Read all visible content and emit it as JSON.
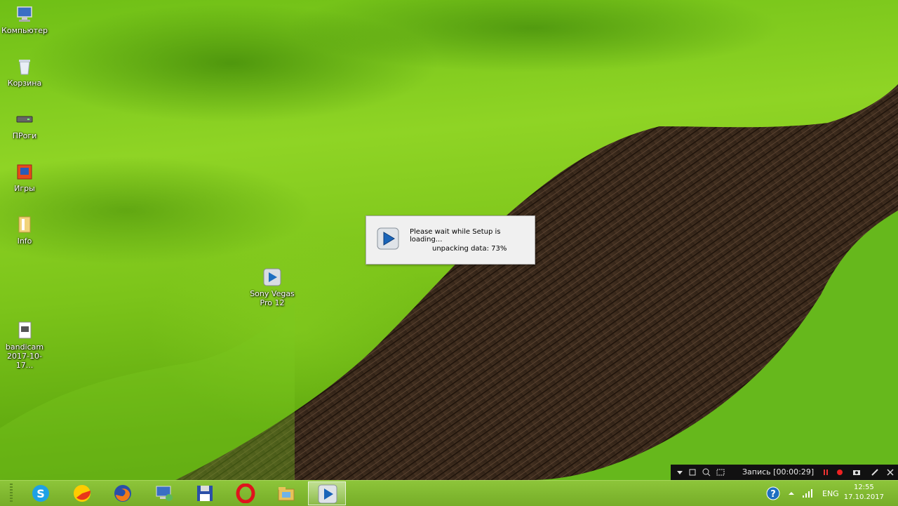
{
  "desktop": {
    "icons": [
      {
        "label": "Компьютер",
        "icon": "computer-icon"
      },
      {
        "label": "Корзина",
        "icon": "recycle-bin-icon"
      },
      {
        "label": "ПРоги",
        "icon": "drive-icon"
      },
      {
        "label": "Игры",
        "icon": "games-folder-icon"
      },
      {
        "label": "Info",
        "icon": "folder-icon"
      },
      {
        "label_line1": "Sony Vegas",
        "label_line2": "Pro 12",
        "icon": "sony-vegas-icon"
      },
      {
        "label_line1": "bandicam",
        "label_line2": "2017-10-17...",
        "icon": "video-file-icon"
      }
    ]
  },
  "dialog": {
    "message": "Please wait while Setup is loading...",
    "progress_text": "unpacking data: 73%",
    "progress_percent": 73
  },
  "bandicam": {
    "record_text": "Запись [00:00:29]"
  },
  "taskbar": {
    "apps": [
      "skype-icon",
      "yandex-browser-icon",
      "firefox-icon",
      "remote-desktop-icon",
      "floppy-save-icon",
      "opera-icon",
      "file-explorer-icon",
      "sony-vegas-setup-icon"
    ],
    "language": "ENG",
    "time": "12:55",
    "date": "17.10.2017"
  },
  "colors": {
    "taskbar": "#82bb30",
    "soil": "#3b2a1c",
    "dialog_bg": "#f0f0f0"
  }
}
